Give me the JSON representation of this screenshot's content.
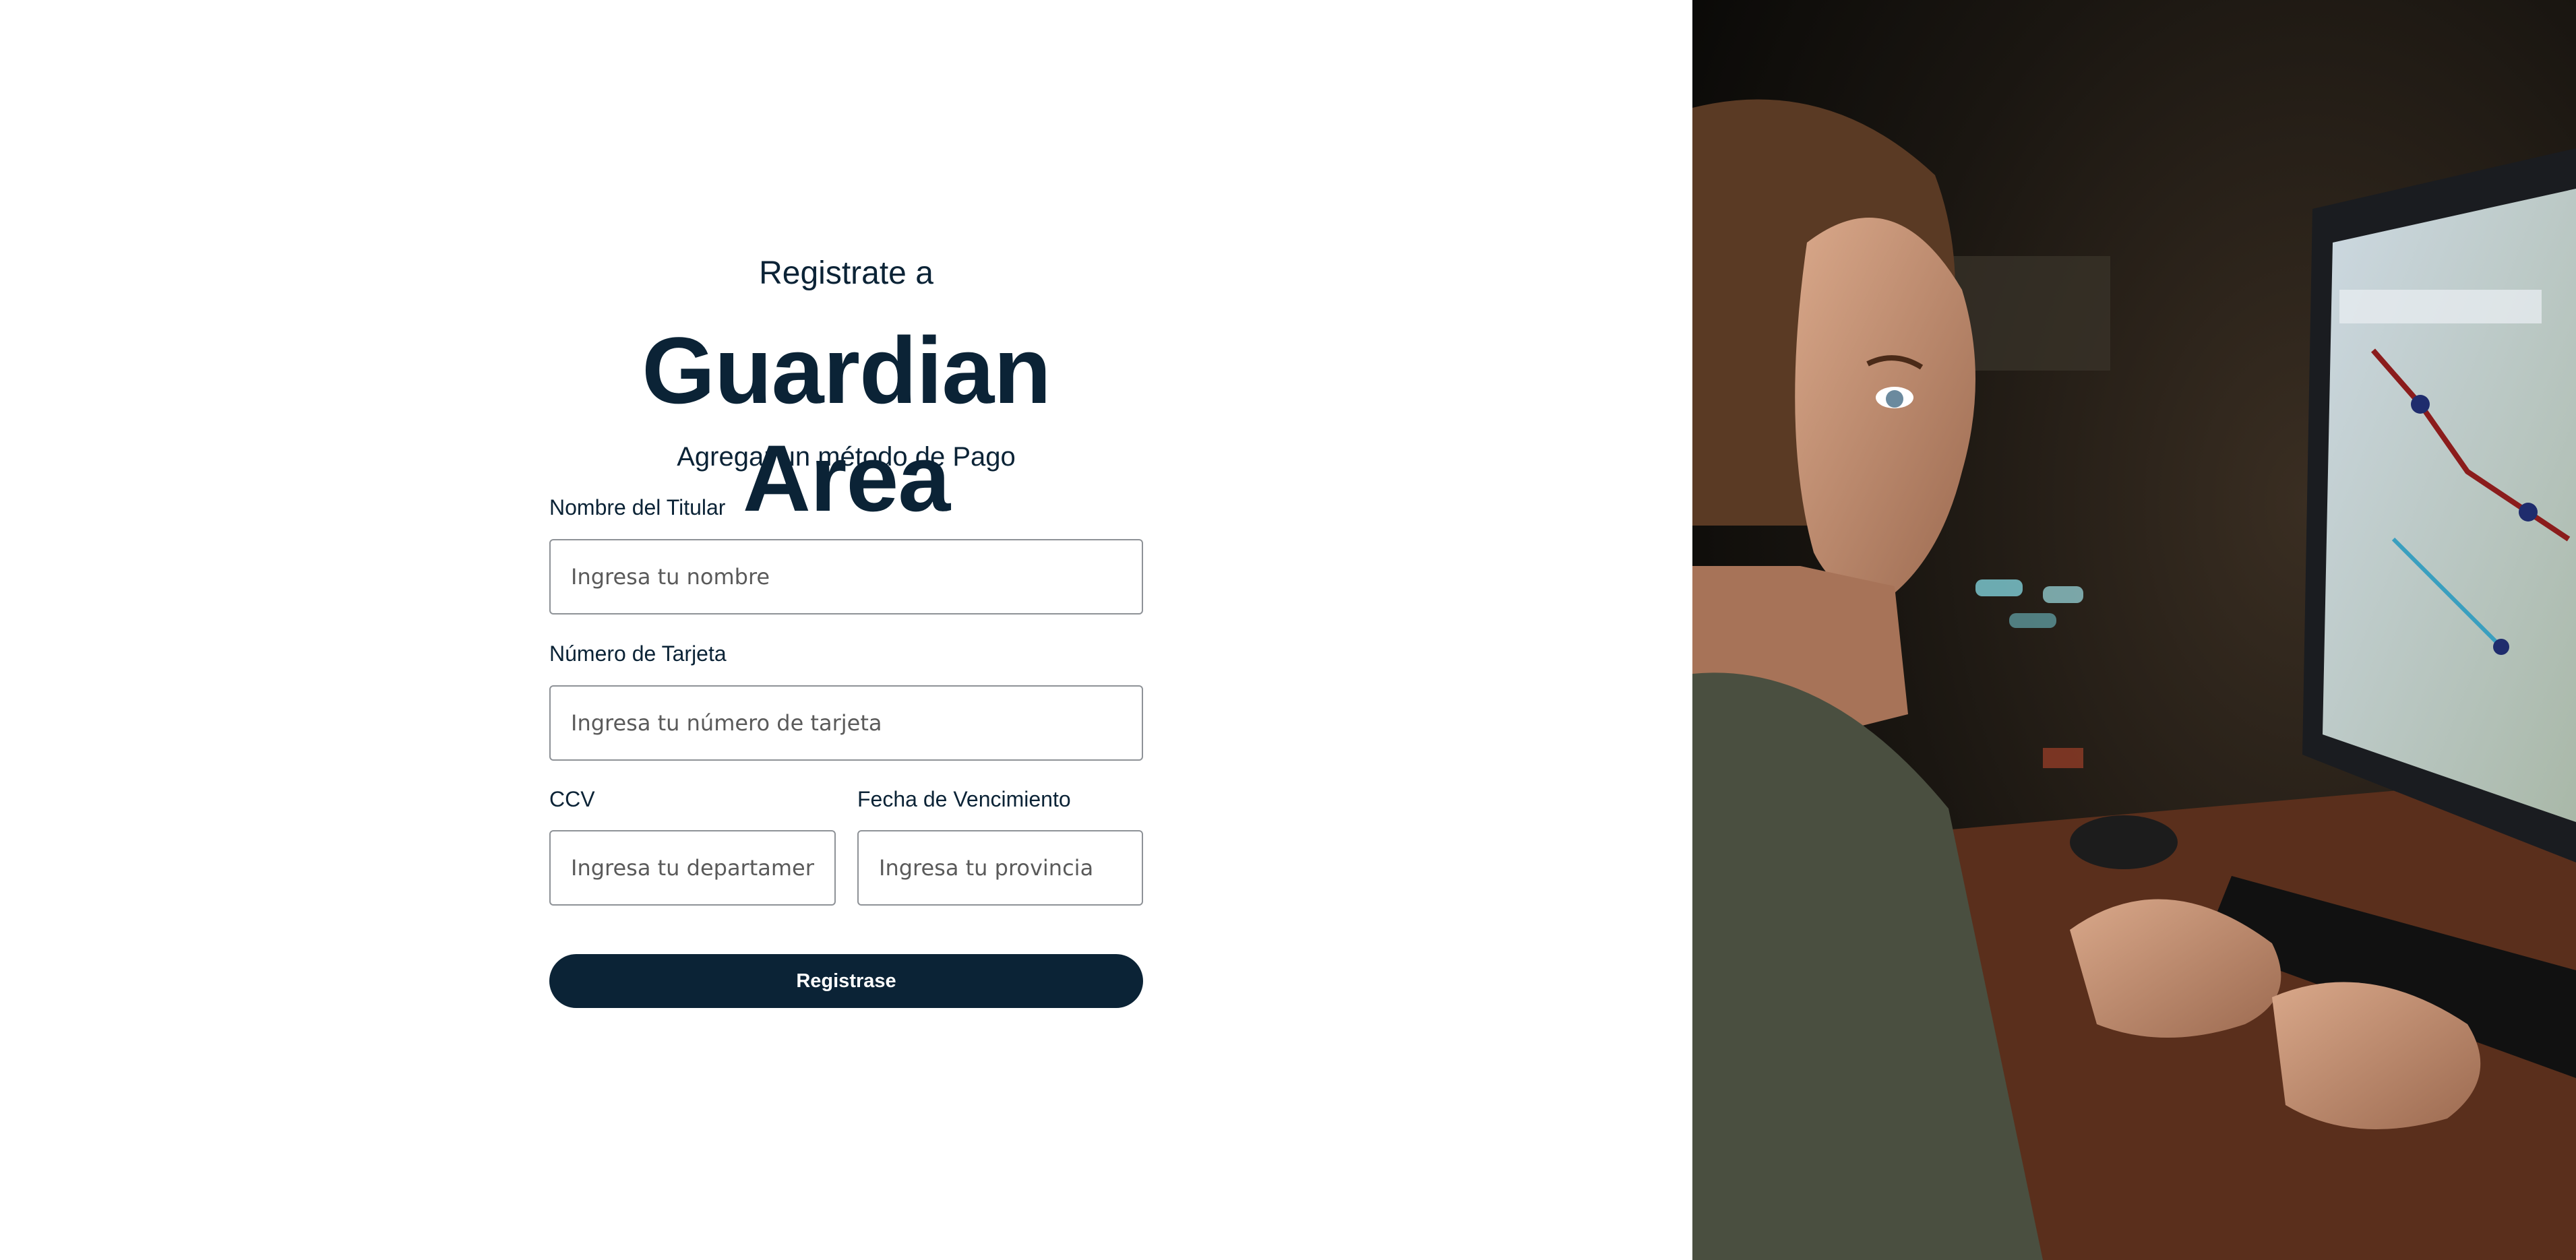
{
  "header": {
    "pre_title": "Registrate a",
    "brand": "Guardian Area",
    "subtitle": "Agregar un método de Pago"
  },
  "form": {
    "holder_label": "Nombre del Titular",
    "holder_placeholder": "Ingresa tu nombre",
    "card_label": "Número de Tarjeta",
    "card_placeholder": "Ingresa tu número de tarjeta",
    "ccv_label": "CCV",
    "ccv_placeholder": "Ingresa tu departamento",
    "expiry_label": "Fecha de Vencimiento",
    "expiry_placeholder": "Ingresa tu provincia",
    "submit_label": "Registrase"
  },
  "colors": {
    "primary": "#0b2336",
    "background": "#ffffff",
    "input_border": "#8e9297"
  },
  "hero_image": {
    "icon": "person-at-computer-map-illustration"
  }
}
